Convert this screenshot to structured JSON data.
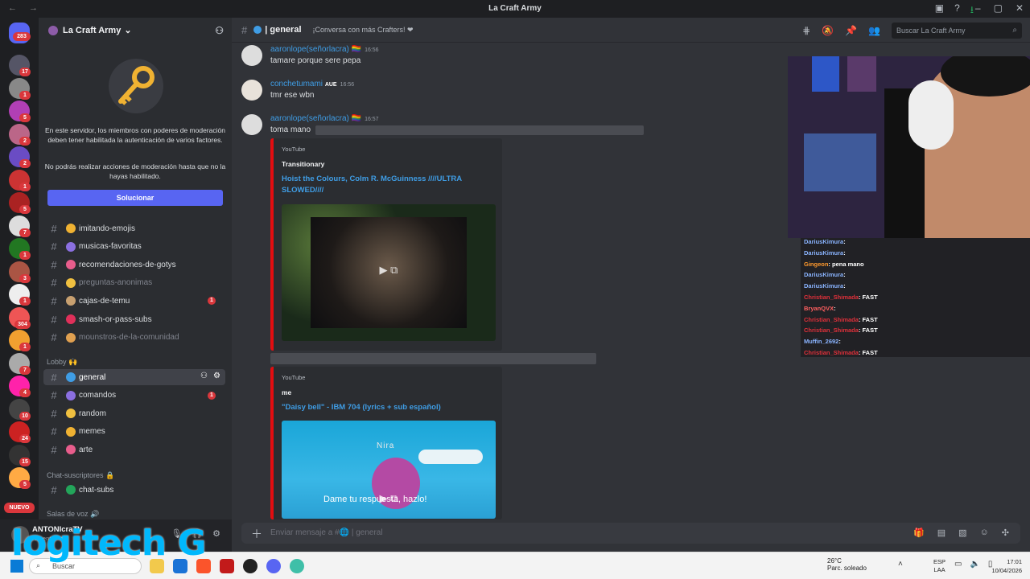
{
  "window": {
    "title": "La Craft Army",
    "nav": "←  →"
  },
  "servers": {
    "home_badge": "283",
    "badges": [
      "17",
      "1",
      "5",
      "2",
      "2",
      "1",
      "5",
      "7",
      "1",
      "3",
      "1",
      "304",
      "1",
      "7",
      "4",
      "10",
      "24",
      "15",
      "5"
    ],
    "new_label": "NUEVO"
  },
  "guild": {
    "name": "La Craft Army",
    "chevron": "⌄"
  },
  "mod_notice": {
    "text1": "En este servidor, los miembros con poderes de moderación deben tener habilitada la autenticación de varios factores.",
    "text2": "No podrás realizar acciones de moderación hasta que no la hayas habilitado.",
    "button": "Solucionar"
  },
  "channels": [
    {
      "name": "imitando-emojis",
      "muted": false,
      "badge": ""
    },
    {
      "name": "musicas-favoritas",
      "muted": false,
      "badge": ""
    },
    {
      "name": "recomendaciones-de-gotys",
      "muted": false,
      "badge": ""
    },
    {
      "name": "preguntas-anonimas",
      "muted": true,
      "badge": ""
    },
    {
      "name": "cajas-de-temu",
      "muted": false,
      "badge": "1"
    },
    {
      "name": "smash-or-pass-subs",
      "muted": false,
      "badge": ""
    },
    {
      "name": "mounstros-de-la-comunidad",
      "muted": true,
      "badge": ""
    }
  ],
  "categories": {
    "lobby": "Lobby 🙌",
    "subs": "Chat-suscriptores 🔒",
    "voice": "Salas de voz 🔊"
  },
  "lobby_channels": [
    {
      "name": "general",
      "badge": ""
    },
    {
      "name": "comandos",
      "badge": "1"
    },
    {
      "name": "random",
      "badge": ""
    },
    {
      "name": "memes",
      "badge": ""
    },
    {
      "name": "arte",
      "badge": ""
    }
  ],
  "sub_channel": "chat-subs",
  "user": {
    "name": "ANTONIcraTV",
    "status": "Ausente"
  },
  "header": {
    "channel": "| general",
    "topic": "¡Conversa con más Crafters! ❤",
    "search_placeholder": "Buscar La Craft Army"
  },
  "messages": [
    {
      "author": "aaronlope(señorlacra) 🏳️‍🌈",
      "time": "16:56",
      "text": "tamare porque sere pepa"
    },
    {
      "author": "conchetumami",
      "tag": "AUE",
      "time": "16:56",
      "text": "tmr ese wbn"
    },
    {
      "author": "aaronlope(señorlacra) 🏳️‍🌈",
      "time": "16:57",
      "text": "toma mano"
    }
  ],
  "embeds": [
    {
      "source": "YouTube",
      "author": "Transitionary",
      "title": "Hoist the Colours, Colm R. McGuinness ////ULTRA SLOWED////"
    },
    {
      "source": "YouTube",
      "author": "me",
      "title": "\"Daisy bell\" - IBM 704 (lyrics + sub español)",
      "thumb_text_top": "Nira",
      "thumb_text": "Dame tu respuesta, hazlo!"
    }
  ],
  "composer": {
    "placeholder": "Enviar mensaje a #🌐 | general"
  },
  "stream_chat": [
    {
      "user": "DariusKimura",
      "color": "#8ab4ff",
      "text": ":"
    },
    {
      "user": "DariusKimura",
      "color": "#8ab4ff",
      "text": ":"
    },
    {
      "user": "Gingeon",
      "color": "#ff9a2e",
      "text": ": pena mano"
    },
    {
      "user": "DariusKimura",
      "color": "#8ab4ff",
      "text": ":"
    },
    {
      "user": "DariusKimura",
      "color": "#8ab4ff",
      "text": ":"
    },
    {
      "user": "Christian_Shimada",
      "color": "#e0303a",
      "text": ": FAST"
    },
    {
      "user": "BryanQVX",
      "color": "#ff5f5f",
      "text": ":"
    },
    {
      "user": "Christian_Shimada",
      "color": "#e0303a",
      "text": ": FAST"
    },
    {
      "user": "Christian_Shimada",
      "color": "#e0303a",
      "text": ": FAST"
    },
    {
      "user": "Muffin_2692",
      "color": "#8ab4ff",
      "text": ":"
    },
    {
      "user": "Christian_Shimada",
      "color": "#e0303a",
      "text": ": FAST"
    }
  ],
  "taskbar": {
    "search": "Buscar",
    "temp": "26°C",
    "weather": "Parc. soleado",
    "lang1": "ESP",
    "lang2": "LAA",
    "time": "17:01",
    "date": "10/04/2026"
  },
  "watermark": "logitech G",
  "colors": {
    "accent": "#5865f2",
    "link": "#3f9de5",
    "danger": "#da373c",
    "youtube": "#e30d10"
  }
}
